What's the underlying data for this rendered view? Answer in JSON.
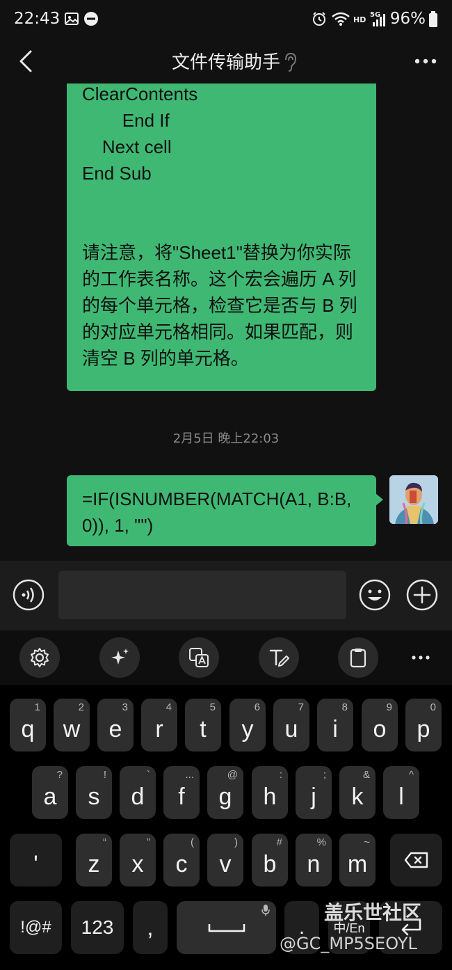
{
  "status_bar": {
    "time": "22:43",
    "battery": "96%",
    "network_hd": "HD",
    "network_5g": "5G"
  },
  "header": {
    "title": "文件传输助手",
    "back_icon": "chevron-left-icon",
    "ear_icon": "ear-icon",
    "more_icon": "more-dots-icon"
  },
  "messages": {
    "bubble1_lines": [
      "ClearContents",
      "        End If",
      "    Next cell",
      "End Sub"
    ],
    "bubble1_para": [
      "请注意，将\"Sheet1\"替换为你实际",
      "的工作表名称。这个宏会遍历 A 列",
      "的每个单元格，检查它是否与 B 列",
      "的对应单元格相同。如果匹配，则",
      "清空 B 列的单元格。"
    ],
    "timestamp": "2月5日 晚上22:03",
    "bubble2_lines": [
      "=IF(ISNUMBER(MATCH(A1, B:B,",
      "0)), 1, \"\")"
    ]
  },
  "input_bar": {
    "voice_icon": "voice-input-icon",
    "emoji_icon": "emoji-icon",
    "plus_icon": "plus-icon",
    "text_value": ""
  },
  "toolbar": {
    "icons": [
      "settings-icon",
      "sparkle-icon",
      "translate-icon",
      "text-style-icon",
      "clipboard-icon",
      "more-dots-icon"
    ]
  },
  "keyboard": {
    "row1": [
      {
        "key": "q",
        "hint": "1"
      },
      {
        "key": "w",
        "hint": "2"
      },
      {
        "key": "e",
        "hint": "3"
      },
      {
        "key": "r",
        "hint": "4"
      },
      {
        "key": "t",
        "hint": "5"
      },
      {
        "key": "y",
        "hint": "6"
      },
      {
        "key": "u",
        "hint": "7"
      },
      {
        "key": "i",
        "hint": "8"
      },
      {
        "key": "o",
        "hint": "9"
      },
      {
        "key": "p",
        "hint": "0"
      }
    ],
    "row2": [
      {
        "key": "a",
        "hint": "?"
      },
      {
        "key": "s",
        "hint": "!"
      },
      {
        "key": "d",
        "hint": "`"
      },
      {
        "key": "f",
        "hint": "..."
      },
      {
        "key": "g",
        "hint": "@"
      },
      {
        "key": "h",
        "hint": ":"
      },
      {
        "key": "j",
        "hint": ";"
      },
      {
        "key": "k",
        "hint": "&"
      },
      {
        "key": "l",
        "hint": "^"
      }
    ],
    "row3": [
      {
        "key": "'",
        "hint": ""
      },
      {
        "key": "z",
        "hint": "“"
      },
      {
        "key": "x",
        "hint": "”"
      },
      {
        "key": "c",
        "hint": "("
      },
      {
        "key": "v",
        "hint": ")"
      },
      {
        "key": "b",
        "hint": "#"
      },
      {
        "key": "n",
        "hint": "%"
      },
      {
        "key": "m",
        "hint": "~"
      }
    ],
    "symbols_key": "!@#",
    "numbers_key": "123",
    "comma_key": ",",
    "lang_key": "中/En",
    "mic_icon": "mic-icon",
    "backspace_icon": "backspace-icon",
    "enter_icon": "enter-icon",
    "space_icon": "space-bar-icon"
  },
  "watermark": {
    "title": "盖乐世社区",
    "user": "@GC_MP5SEOYL"
  }
}
